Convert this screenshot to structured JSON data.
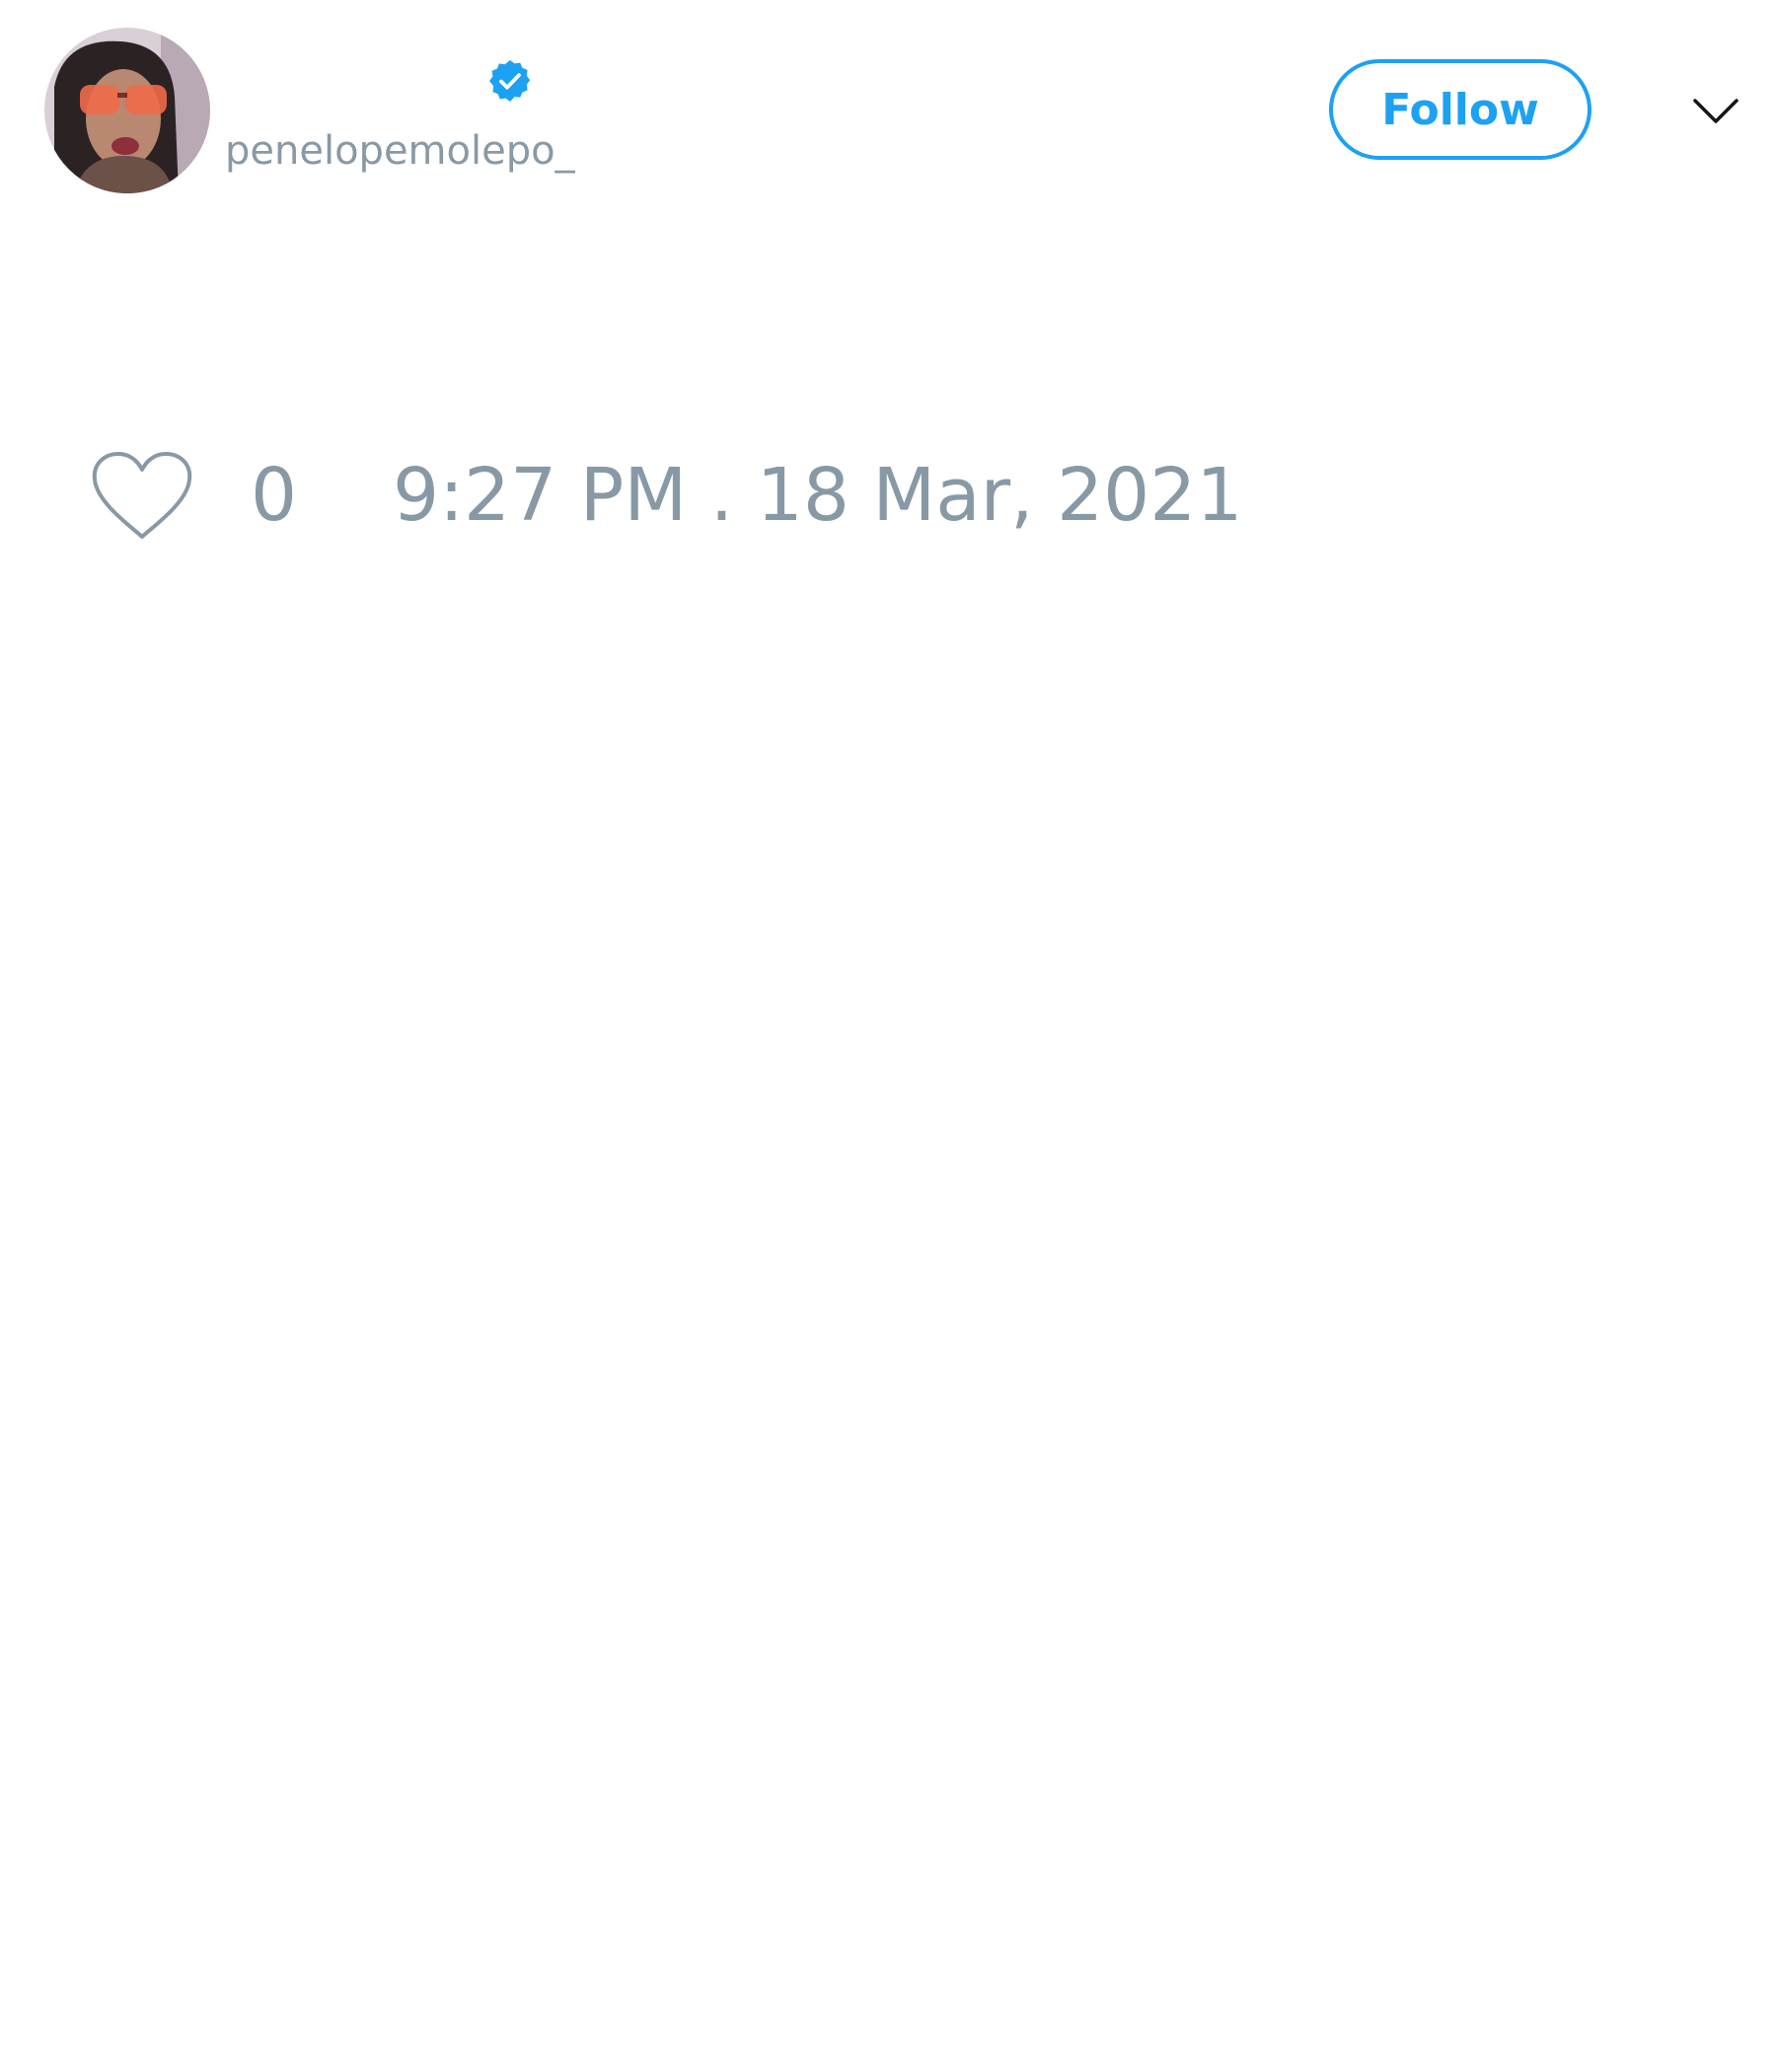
{
  "tweet": {
    "user": {
      "handle": "penelopemolepo_",
      "verified": true,
      "avatar_icon": "profile-photo"
    },
    "follow_label": "Follow",
    "menu_icon": "chevron-down-icon",
    "like_icon": "heart-outline-icon",
    "like_count": "0",
    "timestamp": "9:27 PM . 18 Mar, 2021"
  },
  "colors": {
    "accent": "#1da1f2",
    "muted_text": "#8899a6",
    "background": "#ffffff",
    "icon_dark": "#14171a"
  }
}
